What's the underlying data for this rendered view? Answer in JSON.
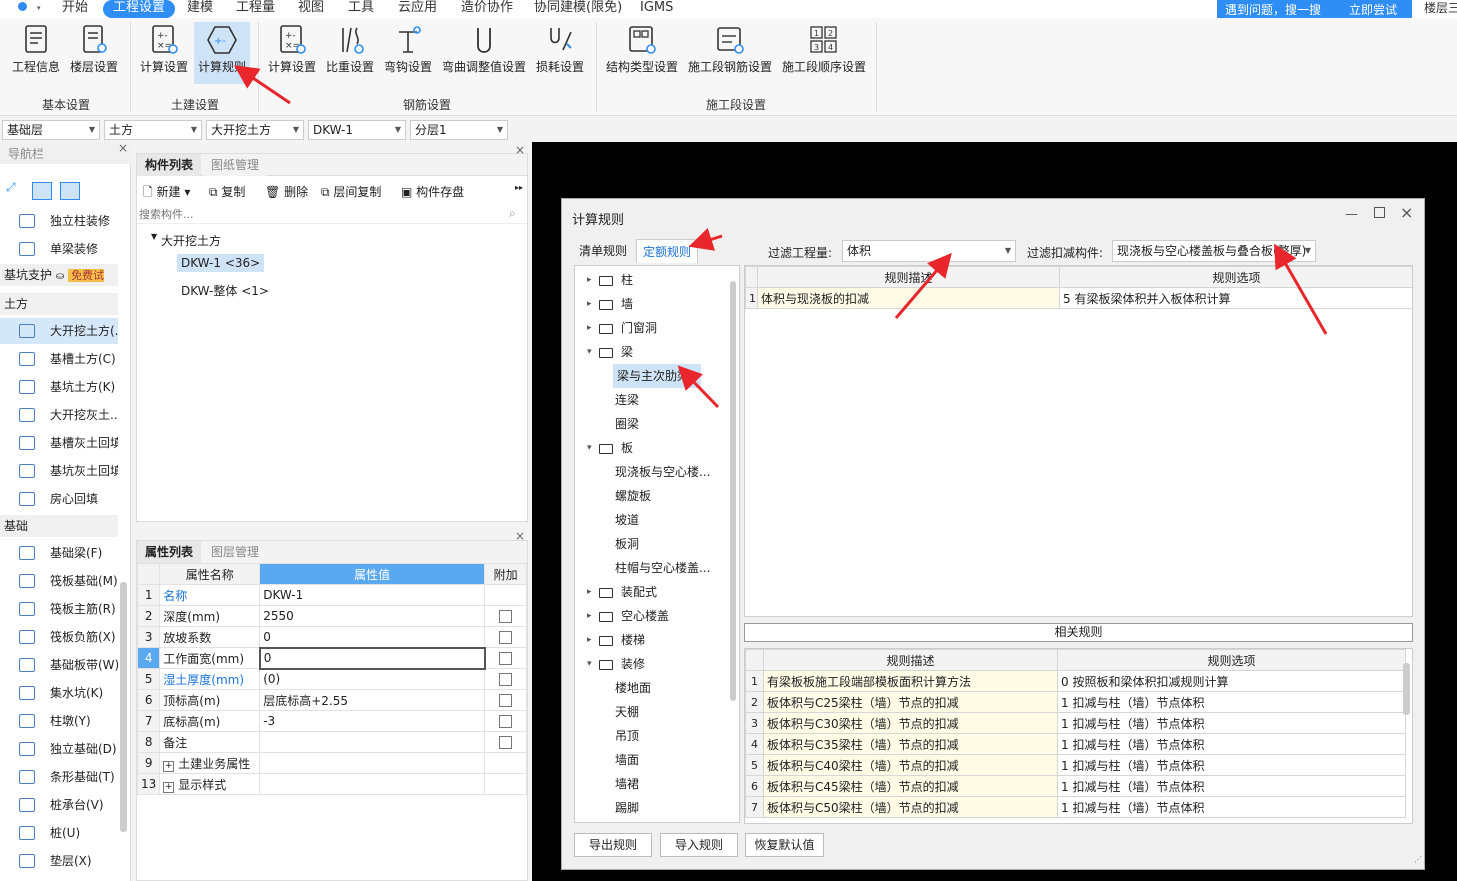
{
  "menubar": {
    "items": [
      "开始",
      "工程设置",
      "建模",
      "工程量",
      "视图",
      "工具",
      "云应用",
      "造价协作",
      "协同建模(限免)",
      "IGMS"
    ],
    "active_index": 1,
    "help_text": "遇到问题，搜一搜",
    "help_button": "立即尝试",
    "right_text": "楼层三"
  },
  "ribbon": {
    "buttons": [
      "工程信息",
      "楼层设置",
      "计算设置",
      "计算规则",
      "计算设置",
      "比重设置",
      "弯钩设置",
      "弯曲调整值设置",
      "损耗设置",
      "结构类型设置",
      "施工段钢筋设置",
      "施工段顺序设置"
    ],
    "selected": "计算规则",
    "groups": [
      "基本设置",
      "土建设置",
      "钢筋设置",
      "施工段设置"
    ]
  },
  "selectors": [
    "基础层",
    "土方",
    "大开挖土方",
    "DKW-1",
    "分层1"
  ],
  "nav": {
    "title": "导航栏",
    "items_top": [
      "独立柱装修",
      "单梁装修"
    ],
    "support_label": "基坑支护",
    "trial_badge": "免费试用",
    "cat_tufang": "土方",
    "tufang_items": [
      "大开挖土方(..",
      "基槽土方(C)",
      "基坑土方(K)",
      "大开挖灰土...",
      "基槽灰土回填",
      "基坑灰土回填",
      "房心回填"
    ],
    "cat_jichu": "基础",
    "jichu_items": [
      "基础梁(F)",
      "筏板基础(M)",
      "筏板主筋(R)",
      "筏板负筋(X)",
      "基础板带(W)",
      "集水坑(K)",
      "柱墩(Y)",
      "独立基础(D)",
      "条形基础(T)",
      "桩承台(V)",
      "桩(U)",
      "垫层(X)"
    ]
  },
  "complist": {
    "tabs": [
      "构件列表",
      "图纸管理"
    ],
    "toolbar": [
      "新建",
      "复制",
      "删除",
      "层间复制",
      "构件存盘"
    ],
    "search_placeholder": "搜索构件...",
    "group": "大开挖土方",
    "items": [
      "DKW-1 <36>",
      "DKW-整体 <1>"
    ]
  },
  "proplist": {
    "tabs": [
      "属性列表",
      "图层管理"
    ],
    "headers": [
      "属性名称",
      "属性值",
      "附加"
    ],
    "rows": [
      {
        "n": "1",
        "name": "名称",
        "value": "DKW-1",
        "blue": true,
        "cb": false
      },
      {
        "n": "2",
        "name": "深度(mm)",
        "value": "2550",
        "blue": false,
        "cb": true
      },
      {
        "n": "3",
        "name": "放坡系数",
        "value": "0",
        "blue": false,
        "cb": true
      },
      {
        "n": "4",
        "name": "工作面宽(mm)",
        "value": "0",
        "blue": false,
        "cb": true
      },
      {
        "n": "5",
        "name": "湿土厚度(mm)",
        "value": "(0)",
        "blue": true,
        "cb": true
      },
      {
        "n": "6",
        "name": "顶标高(m)",
        "value": "层底标高+2.55",
        "blue": false,
        "cb": true
      },
      {
        "n": "7",
        "name": "底标高(m)",
        "value": "-3",
        "blue": false,
        "cb": true
      },
      {
        "n": "8",
        "name": "备注",
        "value": "",
        "blue": false,
        "cb": true
      },
      {
        "n": "9",
        "name": "土建业务属性",
        "value": "",
        "blue": false,
        "cb": false
      },
      {
        "n": "13",
        "name": "显示样式",
        "value": "",
        "blue": false,
        "cb": false
      }
    ]
  },
  "dialog": {
    "title": "计算规则",
    "tabs": [
      "清单规则",
      "定额规则"
    ],
    "filter_qty_label": "过滤工程量:",
    "filter_qty_value": "体积",
    "filter_comp_label": "过滤扣减构件:",
    "filter_comp_value": "现浇板与空心楼盖板与叠合板(整厚)",
    "tree": [
      {
        "label": "柱",
        "folder": true,
        "toggle": "▸"
      },
      {
        "label": "墙",
        "folder": true,
        "toggle": "▸"
      },
      {
        "label": "门窗洞",
        "folder": true,
        "toggle": "▸"
      },
      {
        "label": "梁",
        "folder": true,
        "toggle": "▾"
      },
      {
        "label": "梁与主次肋梁",
        "folder": false,
        "sel": true
      },
      {
        "label": "连梁",
        "folder": false
      },
      {
        "label": "圈梁",
        "folder": false
      },
      {
        "label": "板",
        "folder": true,
        "toggle": "▾"
      },
      {
        "label": "现浇板与空心楼...",
        "folder": false
      },
      {
        "label": "螺旋板",
        "folder": false
      },
      {
        "label": "坡道",
        "folder": false
      },
      {
        "label": "板洞",
        "folder": false
      },
      {
        "label": "柱帽与空心楼盖...",
        "folder": false
      },
      {
        "label": "装配式",
        "folder": true,
        "toggle": "▸"
      },
      {
        "label": "空心楼盖",
        "folder": true,
        "toggle": "▸"
      },
      {
        "label": "楼梯",
        "folder": true,
        "toggle": "▸"
      },
      {
        "label": "装修",
        "folder": true,
        "toggle": "▾"
      },
      {
        "label": "楼地面",
        "folder": false
      },
      {
        "label": "天棚",
        "folder": false
      },
      {
        "label": "吊顶",
        "folder": false
      },
      {
        "label": "墙面",
        "folder": false
      },
      {
        "label": "墙裙",
        "folder": false
      },
      {
        "label": "踢脚",
        "folder": false
      }
    ],
    "grid_headers": [
      "规则描述",
      "规则选项"
    ],
    "main_rows": [
      {
        "n": "1",
        "desc": "体积与现浇板的扣减",
        "opt": "5 有梁板梁体积并入板体积计算"
      }
    ],
    "related_title": "相关规则",
    "related_rows": [
      {
        "n": "1",
        "desc": "有梁板板施工段端部模板面积计算方法",
        "opt": "0 按照板和梁体积扣减规则计算"
      },
      {
        "n": "2",
        "desc": "板体积与C25梁柱（墙）节点的扣减",
        "opt": "1 扣减与柱（墙）节点体积"
      },
      {
        "n": "3",
        "desc": "板体积与C30梁柱（墙）节点的扣减",
        "opt": "1 扣减与柱（墙）节点体积"
      },
      {
        "n": "4",
        "desc": "板体积与C35梁柱（墙）节点的扣减",
        "opt": "1 扣减与柱（墙）节点体积"
      },
      {
        "n": "5",
        "desc": "板体积与C40梁柱（墙）节点的扣减",
        "opt": "1 扣减与柱（墙）节点体积"
      },
      {
        "n": "6",
        "desc": "板体积与C45梁柱（墙）节点的扣减",
        "opt": "1 扣减与柱（墙）节点体积"
      },
      {
        "n": "7",
        "desc": "板体积与C50梁柱（墙）节点的扣减",
        "opt": "1 扣减与柱（墙）节点体积"
      }
    ],
    "buttons": [
      "导出规则",
      "导入规则",
      "恢复默认值"
    ]
  },
  "colors": {
    "accent": "#2f8ef5",
    "selected": "#cfe3f7",
    "arrow": "#e8262b",
    "desc_bg": "#fffbe6"
  }
}
